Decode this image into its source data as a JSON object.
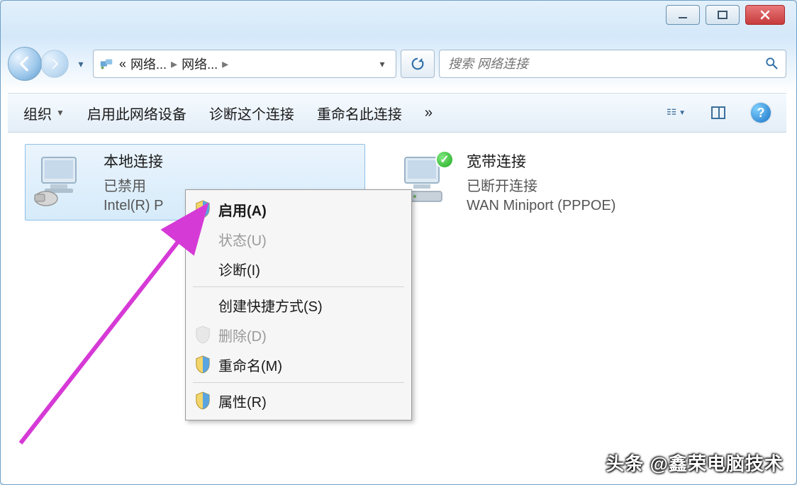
{
  "window_buttons": {
    "minimize": "min",
    "maximize": "max",
    "close": "close"
  },
  "breadcrumb": {
    "prefix": "«",
    "part1": "网络...",
    "part2": "网络..."
  },
  "search": {
    "placeholder": "搜索 网络连接"
  },
  "toolbar": {
    "organize": "组织",
    "enable_device": "启用此网络设备",
    "diagnose": "诊断这个连接",
    "rename": "重命名此连接",
    "overflow": "»"
  },
  "connections": [
    {
      "name": "本地连接",
      "status": "已禁用",
      "device": "Intel(R) P",
      "selected": true,
      "ok_badge": false
    },
    {
      "name": "宽带连接",
      "status": "已断开连接",
      "device": "WAN Miniport (PPPOE)",
      "selected": false,
      "ok_badge": true
    }
  ],
  "context_menu": {
    "enable": "启用(A)",
    "status": "状态(U)",
    "diagnose": "诊断(I)",
    "create_shortcut": "创建快捷方式(S)",
    "delete": "删除(D)",
    "rename": "重命名(M)",
    "properties": "属性(R)"
  },
  "watermark": "头条 @鑫荣电脑技术"
}
